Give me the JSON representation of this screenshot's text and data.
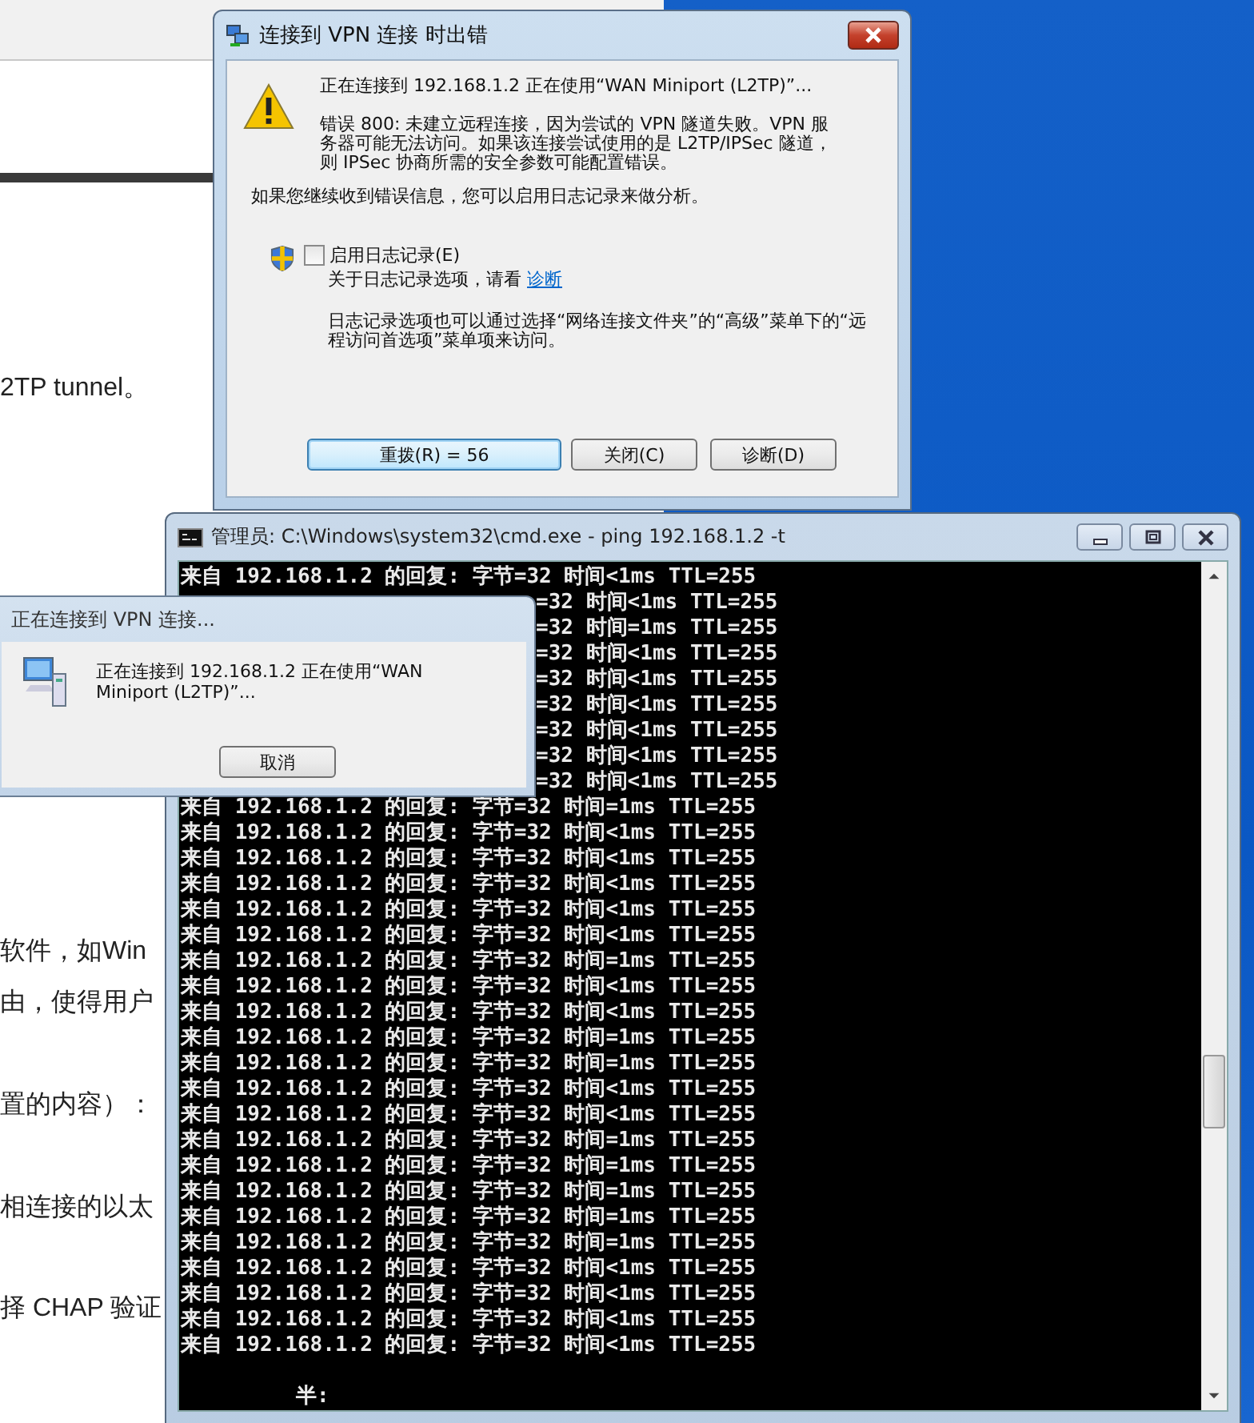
{
  "browser_page": {
    "paragraphs": [
      "2TP tunnel。",
      "软件，如Win",
      "由，使得用户",
      "置的内容）：",
      "相连接的以太",
      "择 CHAP 验证"
    ]
  },
  "error_dialog": {
    "title": "连接到 VPN 连接 时出错",
    "message": "正在连接到 192.168.1.2 正在使用“WAN Miniport (L2TP)”...",
    "error": "错误 800: 未建立远程连接，因为尝试的 VPN 隧道失败。VPN 服务器可能无法访问。如果该连接尝试使用的是 L2TP/IPSec 隧道，则 IPSec 协商所需的安全参数可能配置错误。",
    "hint": "如果您继续收到错误信息，您可以启用日志记录来做分析。",
    "log_checkbox": {
      "label": "启用日志记录(E)",
      "checked": false
    },
    "log_info": {
      "text": "关于日志记录选项，请看",
      "link": "诊断"
    },
    "note": "日志记录选项也可以通过选择“网络连接文件夹”的“高级”菜单下的“远程访问首选项”菜单项来访问。",
    "buttons": [
      {
        "label": "重拨(R) = 56",
        "default": true
      },
      {
        "label": "关闭(C)",
        "default": false
      },
      {
        "label": "诊断(D)",
        "default": false
      }
    ]
  },
  "cmd_window": {
    "title": "管理员: C:\\Windows\\system32\\cmd.exe - ping  192.168.1.2 -t",
    "lines": [
      {
        "kind": "full",
        "text": "来自 192.168.1.2 的回复: 字节=32 时间<1ms TTL=255"
      },
      {
        "kind": "partial",
        "text": "=32 时间<1ms TTL=255"
      },
      {
        "kind": "partial",
        "text": "=32 时间=1ms TTL=255"
      },
      {
        "kind": "partial",
        "text": "=32 时间<1ms TTL=255"
      },
      {
        "kind": "partial",
        "text": "=32 时间<1ms TTL=255"
      },
      {
        "kind": "partial",
        "text": "=32 时间<1ms TTL=255"
      },
      {
        "kind": "partial",
        "text": "=32 时间<1ms TTL=255"
      },
      {
        "kind": "partial",
        "text": "=32 时间<1ms TTL=255"
      },
      {
        "kind": "partial",
        "text": "=32 时间<1ms TTL=255"
      },
      {
        "kind": "full",
        "text": "来自 192.168.1.2 的回复: 字节=32 时间=1ms TTL=255"
      },
      {
        "kind": "full",
        "text": "来自 192.168.1.2 的回复: 字节=32 时间<1ms TTL=255"
      },
      {
        "kind": "full",
        "text": "来自 192.168.1.2 的回复: 字节=32 时间<1ms TTL=255"
      },
      {
        "kind": "full",
        "text": "来自 192.168.1.2 的回复: 字节=32 时间<1ms TTL=255"
      },
      {
        "kind": "full",
        "text": "来自 192.168.1.2 的回复: 字节=32 时间<1ms TTL=255"
      },
      {
        "kind": "full",
        "text": "来自 192.168.1.2 的回复: 字节=32 时间<1ms TTL=255"
      },
      {
        "kind": "full",
        "text": "来自 192.168.1.2 的回复: 字节=32 时间=1ms TTL=255"
      },
      {
        "kind": "full",
        "text": "来自 192.168.1.2 的回复: 字节=32 时间<1ms TTL=255"
      },
      {
        "kind": "full",
        "text": "来自 192.168.1.2 的回复: 字节=32 时间<1ms TTL=255"
      },
      {
        "kind": "full",
        "text": "来自 192.168.1.2 的回复: 字节=32 时间=1ms TTL=255"
      },
      {
        "kind": "full",
        "text": "来自 192.168.1.2 的回复: 字节=32 时间=1ms TTL=255"
      },
      {
        "kind": "full",
        "text": "来自 192.168.1.2 的回复: 字节=32 时间<1ms TTL=255"
      },
      {
        "kind": "full",
        "text": "来自 192.168.1.2 的回复: 字节=32 时间<1ms TTL=255"
      },
      {
        "kind": "full",
        "text": "来自 192.168.1.2 的回复: 字节=32 时间=1ms TTL=255"
      },
      {
        "kind": "full",
        "text": "来自 192.168.1.2 的回复: 字节=32 时间=1ms TTL=255"
      },
      {
        "kind": "full",
        "text": "来自 192.168.1.2 的回复: 字节=32 时间=1ms TTL=255"
      },
      {
        "kind": "full",
        "text": "来自 192.168.1.2 的回复: 字节=32 时间=1ms TTL=255"
      },
      {
        "kind": "full",
        "text": "来自 192.168.1.2 的回复: 字节=32 时间=1ms TTL=255"
      },
      {
        "kind": "full",
        "text": "来自 192.168.1.2 的回复: 字节=32 时间<1ms TTL=255"
      },
      {
        "kind": "full",
        "text": "来自 192.168.1.2 的回复: 字节=32 时间<1ms TTL=255"
      },
      {
        "kind": "full",
        "text": "来自 192.168.1.2 的回复: 字节=32 时间<1ms TTL=255"
      },
      {
        "kind": "full",
        "text": "来自 192.168.1.2 的回复: 字节=32 时间<1ms TTL=255"
      }
    ],
    "prompt": "半:"
  },
  "progress_dialog": {
    "title": "正在连接到 VPN 连接...",
    "message": "正在连接到 192.168.1.2 正在使用“WAN Miniport (L2TP)”...",
    "button": "取消"
  }
}
